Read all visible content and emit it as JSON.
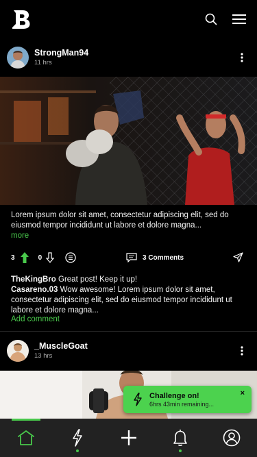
{
  "app": {
    "brand_letter": "B",
    "accent": "#49c84b"
  },
  "header": {
    "icons": [
      "search-icon",
      "menu-icon"
    ]
  },
  "posts": [
    {
      "username": "StrongMan94",
      "time": "11 hrs",
      "caption": "Lorem ipsum dolor sit amet, consectetur adipiscing elit, sed do eiusmod tempor incididunt ut labore et dolore magna...",
      "more_label": "more",
      "upvotes": "3",
      "downvotes": "0",
      "comments_label": "3 Comments",
      "comments": [
        {
          "user": "TheKingBro",
          "text": "Great post! Keep it up!"
        },
        {
          "user": "Casareno.03",
          "text": "Wow awesome! Lorem ipsum dolor sit amet, consectetur adipiscing elit, sed do eiusmod tempor incididunt ut labore et dolore magna..."
        }
      ],
      "add_comment_label": "Add comment"
    },
    {
      "username": "_MuscleGoat",
      "time": "13 hrs"
    }
  ],
  "toast": {
    "title": "Challenge on!",
    "subtitle": "6hrs 43min remaining...",
    "close": "×"
  },
  "bottom_nav": {
    "items": [
      "home-icon",
      "bolt-icon",
      "plus-icon",
      "bell-icon",
      "profile-icon"
    ],
    "active": "home"
  }
}
